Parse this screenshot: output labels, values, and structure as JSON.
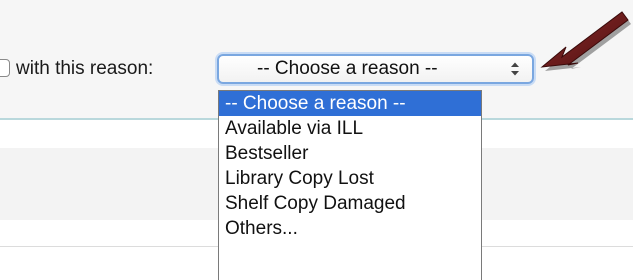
{
  "form": {
    "reason_label": "with this reason:",
    "select": {
      "selected_value": "-- Choose a reason --"
    }
  },
  "dropdown": {
    "options": [
      {
        "label": "-- Choose a reason --",
        "selected": true
      },
      {
        "label": "Available via ILL",
        "selected": false
      },
      {
        "label": "Bestseller",
        "selected": false
      },
      {
        "label": "Library Copy Lost",
        "selected": false
      },
      {
        "label": "Shelf Copy Damaged",
        "selected": false
      },
      {
        "label": "Others...",
        "selected": false
      }
    ]
  },
  "annotation": {
    "arrow_color": "#6b1a1a"
  },
  "colors": {
    "highlight": "#2f6fd6",
    "focus_ring": "#7aa7e0",
    "divider": "#b9d8dc"
  }
}
